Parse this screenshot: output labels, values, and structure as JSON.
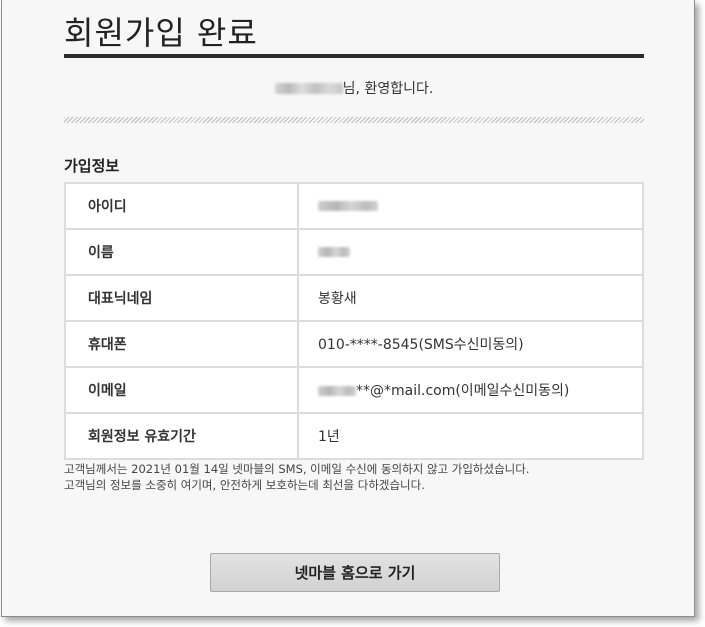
{
  "page": {
    "title": "회원가입 완료",
    "welcome_suffix": "님, 환영합니다.",
    "section_title": "가입정보"
  },
  "info_rows": [
    {
      "label": "아이디",
      "value": ""
    },
    {
      "label": "이름",
      "value": ""
    },
    {
      "label": "대표닉네임",
      "value": "봉황새"
    },
    {
      "label": "휴대폰",
      "value": "010-****-8545(SMS수신미동의)"
    },
    {
      "label": "이메일",
      "value": "**@*mail.com(이메일수신미동의)"
    },
    {
      "label": "회원정보 유효기간",
      "value": "1년"
    }
  ],
  "notice": {
    "line1": "고객님께서는 2021년 01월 14일 넷마블의 SMS, 이메일 수신에 동의하지 않고 가입하셨습니다.",
    "line2": "고객님의 정보를 소중히 여기며, 안전하게 보호하는데 최선을 다하겠습니다."
  },
  "buttons": {
    "home": "넷마블 홈으로 가기"
  }
}
